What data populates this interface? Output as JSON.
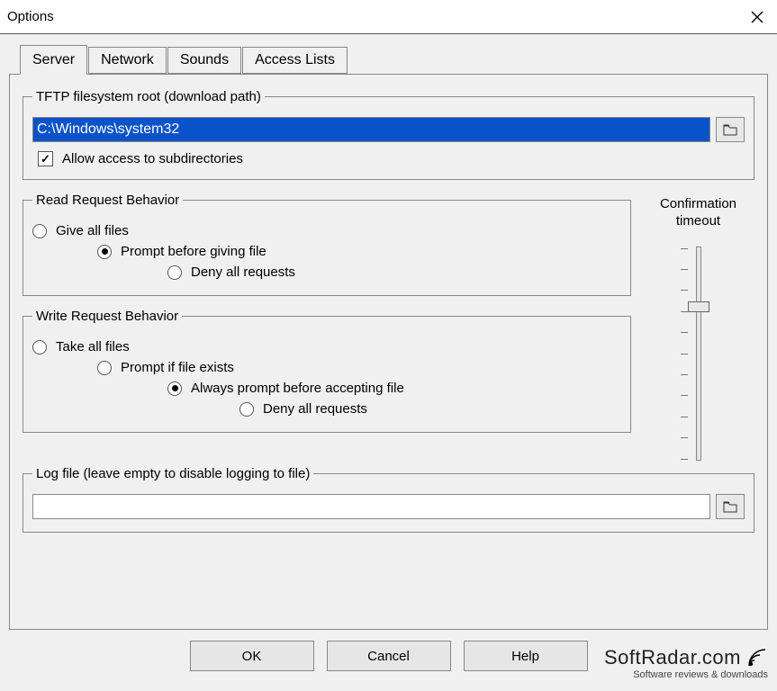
{
  "window": {
    "title": "Options"
  },
  "tabs": {
    "server": "Server",
    "network": "Network",
    "sounds": "Sounds",
    "access_lists": "Access Lists"
  },
  "root": {
    "legend": "TFTP filesystem root (download path)",
    "path": "C:\\Windows\\system32",
    "subdirs_label": "Allow access to subdirectories",
    "subdirs_checked": true
  },
  "read": {
    "legend": "Read Request Behavior",
    "give_all": "Give all files",
    "prompt": "Prompt before giving file",
    "deny": "Deny all requests",
    "selected": "prompt"
  },
  "write": {
    "legend": "Write Request Behavior",
    "take_all": "Take all files",
    "prompt_exists": "Prompt if file exists",
    "always_prompt": "Always prompt before accepting file",
    "deny": "Deny all requests",
    "selected": "always_prompt"
  },
  "confirm": {
    "label_line1": "Confirmation",
    "label_line2": "timeout",
    "slider_value": 0.28
  },
  "log": {
    "legend": "Log file (leave empty to disable logging to file)",
    "value": ""
  },
  "buttons": {
    "ok": "OK",
    "cancel": "Cancel",
    "help": "Help"
  },
  "watermark": {
    "brand": "SoftRadar.com",
    "tagline": "Software reviews & downloads"
  }
}
